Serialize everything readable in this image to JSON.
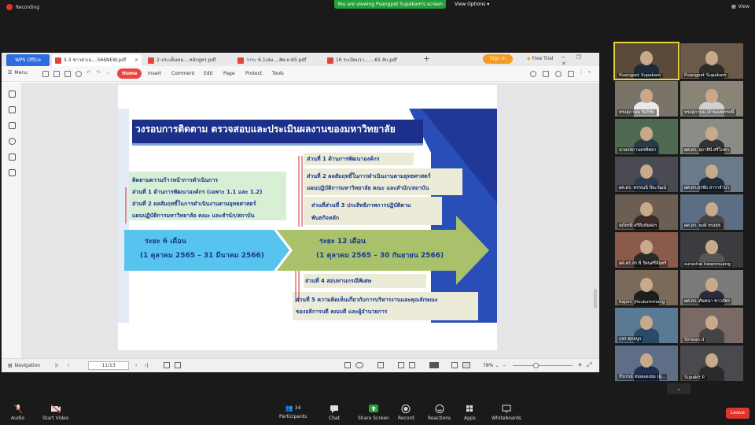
{
  "topbar": {
    "recording": "Recording",
    "viewing": "You are viewing Puangpet Supakam's screen",
    "view_options": "View Options",
    "view": "View"
  },
  "wps": {
    "app_tab": "WPS Office",
    "tabs": [
      {
        "label": "5.3 ข่าวสาเอ....566NEW.pdf",
        "active": true
      },
      {
        "label": "2-ประเด็นขอ....หลักสูตร.pdf",
        "active": false
      },
      {
        "label": "วาระ 6.1เล่ม....8พ.ย.65.pdf",
        "active": false
      },
      {
        "label": "16 ระเบียบวา.......65 ลับ.pdf",
        "active": false
      }
    ],
    "sign_in": "Sign in",
    "free_trial": "Free Trial",
    "menu_label": "Menu",
    "ribbon": [
      "Home",
      "Insert",
      "Comment",
      "Edit",
      "Page",
      "Protect",
      "Tools"
    ],
    "navigation": "Navigation",
    "page_indicator": "11/13",
    "zoom": "78%"
  },
  "slide": {
    "title": "วงรอบการติดตาม ตรวจสอบและประเมินผลงานของมหาวิทยาลัย",
    "left_box": {
      "heading": "ติดตามความก้าวหน้าการดำเนินการ",
      "line1": "ส่วนที่ 1 ด้านการพัฒนาองค์กร (เฉพาะ 1.1 และ 1.2)",
      "line2": "ส่วนที่ 2 ผลสัมฤทธิ์ในการดำเนินงานตามยุทธศาสตร์",
      "line3": "แผนปฏิบัติการมหาวิทยาลัย คณะ และสำนัก/สถาบัน"
    },
    "right_items": {
      "item1": "ส่วนที่ 1 ด้านการพัฒนาองค์กร",
      "item2a": "ส่วนที่ 2 ผลสัมฤทธิ์ในการดำเนินงานตามยุทธศาสตร์",
      "item2b": "แผนปฏิบัติการมหาวิทยาลัย คณะ และสำนัก/สถาบัน",
      "item3a": "ส่วนที่ส่วนที่ 3 ประสิทธิภาพการปฏิบัติตาม",
      "item3b": "พันธกิจหลัก",
      "item4": "ส่วนที่ 4 สอบทานกรณีพิเศษ",
      "item5a": "ส่วนที่ 5 ความคิดเห็นเกี่ยวกับการบริหารงานและคุณลักษณะ",
      "item5b": "ของอธิการบดี คณบดี และผู้อำนวยการ"
    },
    "arrow1": {
      "line1": "ระยะ 6 เดือน",
      "line2": "(1 ตุลาคม 2565 – 31 มีนาคม 2566)"
    },
    "arrow2": {
      "line1": "ระยะ 12 เดือน",
      "line2": "(1 ตุลาคม 2565 – 30 กันยายน 2566)"
    }
  },
  "participants": [
    "Puangpet Supakam",
    "Puangpet Supakam",
    "ทรงสุภานน รัสภิชัย",
    "ทรงสุภานน เจ้าของพรรคนี้",
    "นายกสภานครพิทยา",
    "ผศ.ดร. สุธาสินี ศรีโภคา",
    "ผศ.ดร. พรรณนี ปิยะวัฒน์",
    "ผศ.ดร.สุรชัย สาราจำปา",
    "ทภัทรษี ศรีสิงห์ยศสร",
    "ผศ.ดร. พงษ์ ทรงสุข",
    "ผศ.ดร.สร พี รัตนศรีจันทร์",
    "surachai kwanmuang",
    "Kajorn Jitsukummong",
    "ผศ.ดร. ศันทนา ชาวภัทร",
    "กุจร ศุภยนูร",
    "Siriwan.d",
    "จีรภรณ์ หมอแดงยม (ผู้...",
    "Supakit P."
  ],
  "bottombar": {
    "audio": "Audio",
    "start_video": "Start Video",
    "participants": "Participants",
    "participant_count": "34",
    "chat": "Chat",
    "share_screen": "Share Screen",
    "record": "Record",
    "reactions": "Reactions",
    "apps": "Apps",
    "whiteboards": "Whiteboards",
    "leave": "Leave"
  },
  "colors": {
    "zoom_green": "#23a03b",
    "wps_red": "#e8473d",
    "slide_navy": "#1c2f8a",
    "arrow_blue": "#57c4ef",
    "arrow_olive": "#a9c16a",
    "box_green": "#d8efd6",
    "leave_red": "#e0352b"
  }
}
